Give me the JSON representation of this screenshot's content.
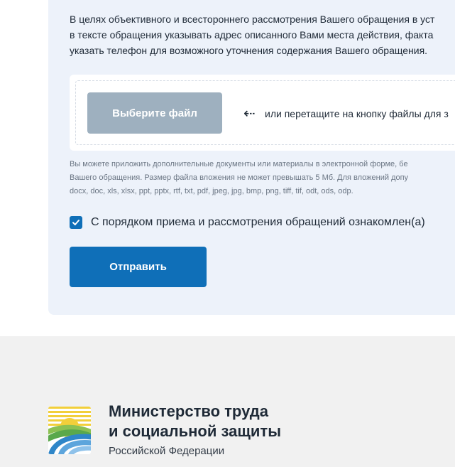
{
  "form": {
    "info_lines": [
      "В целях объективного и всестороннего рассмотрения Вашего обращения в уст",
      "в тексте обращения указывать адрес описанного Вами места действия, факта",
      "указать телефон для возможного уточнения содержания Вашего обращения."
    ],
    "upload": {
      "button_label": "Выберите файл",
      "arrow": "⇠",
      "hint": "или перетащите на кнопку файлы для з"
    },
    "note_lines": [
      "Вы можете приложить дополнительные документы или материалы в электронной форме, бе",
      "Вашего обращения. Размер файла вложения не может превышать 5 Мб. Для вложений допу",
      "docx, doc, xls, xlsx, ppt, pptx, rtf, txt, pdf, jpeg, jpg, bmp, png, tiff, tif, odt, ods, odp."
    ],
    "agreement": {
      "checked": true,
      "label": "С порядком приема и рассмотрения обращений ознакомлен(а)"
    },
    "submit_label": "Отправить"
  },
  "footer": {
    "title_line1": "Министерство труда",
    "title_line2": "и социальной защиты",
    "subtitle": "Российской Федерации"
  },
  "colors": {
    "primary": "#0f6fb8",
    "disabled_button": "#9eb0bf",
    "panel_bg": "#edf2fa",
    "footer_bg": "#f1f1f1"
  }
}
